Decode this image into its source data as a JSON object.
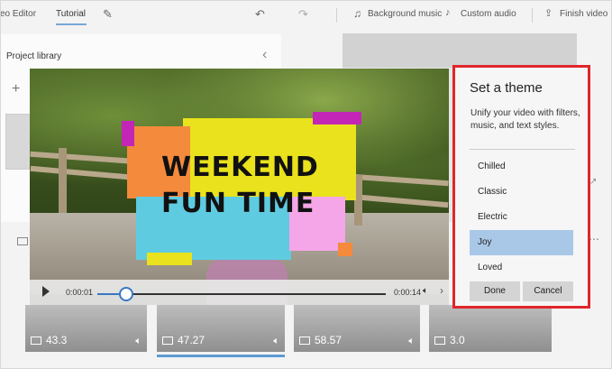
{
  "toolbar": {
    "app_title": "eo Editor",
    "tab": "Tutorial",
    "background_music": "Background music",
    "custom_audio": "Custom audio",
    "finish_video": "Finish video"
  },
  "library": {
    "title": "Project library"
  },
  "player": {
    "title_line1": "WEEKEND",
    "title_line2": "FUN TIME",
    "current_time": "0:00:01",
    "total_time": "0:00:14",
    "progress": 0.1
  },
  "theme": {
    "title": "Set a theme",
    "description": "Unify your video with filters, music, and text styles.",
    "options": [
      "Chilled",
      "Classic",
      "Electric",
      "Joy",
      "Loved"
    ],
    "selected": "Joy",
    "done_label": "Done",
    "cancel_label": "Cancel"
  },
  "storyboard": {
    "clips": [
      {
        "duration": "43.3",
        "type": "video"
      },
      {
        "duration": "47.27",
        "type": "video"
      },
      {
        "duration": "58.57",
        "type": "video"
      },
      {
        "duration": "3.0",
        "type": "image"
      }
    ]
  },
  "colors": {
    "accent": "#3a78c3",
    "selection": "#a9c8e8",
    "highlight_border": "#e0262b",
    "title_yellow": "#e9e21c",
    "title_orange": "#f48a3c",
    "title_cyan": "#5fcbe0",
    "title_pink": "#f5a6e8",
    "title_magenta": "#c326b5"
  }
}
